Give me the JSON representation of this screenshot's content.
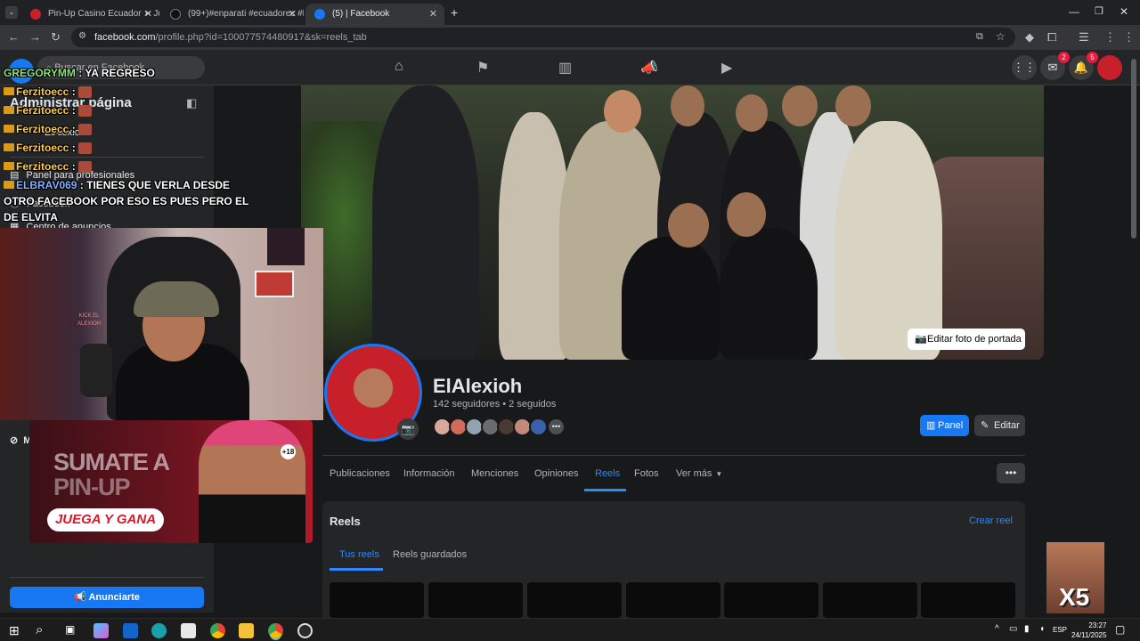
{
  "browser": {
    "tabs": [
      {
        "label": "Pin-Up Casino Ecuador ➤ Juga",
        "active": false
      },
      {
        "label": "(99+)#enparati #ecuadorec #ki",
        "active": false
      },
      {
        "label": "(5) | Facebook",
        "active": true
      }
    ],
    "url_host": "facebook.com",
    "url_path": "/profile.php?id=100077574480917&sk=reels_tab"
  },
  "fb_header": {
    "search_placeholder": "Buscar en Facebook",
    "messenger_badge": "2",
    "notifications_badge": "5"
  },
  "sidebar": {
    "title": "Administrar página",
    "page_name": "ElAlexioh",
    "items": [
      "Panel para profesionales",
      "Facebook",
      "Centro de anuncios"
    ],
    "partial_item": "Me",
    "ads_button": "Anunciarte"
  },
  "chat": [
    {
      "user": "GREGORYMM",
      "text": "YA REGRESO"
    },
    {
      "user": "Ferzitoecc",
      "text": ""
    },
    {
      "user": "Ferzitoecc",
      "text": ""
    },
    {
      "user": "Ferzitoecc",
      "text": ""
    },
    {
      "user": "Ferzitoecc",
      "text": ""
    },
    {
      "user": "Ferzitoecc",
      "text": ""
    },
    {
      "user": "ELBRAV069",
      "text": "TIENES QUE VERLA DESDE"
    },
    {
      "user": "",
      "text": "OTRO FACEBOOK POR ESO ES PUES PERO EL"
    },
    {
      "user": "",
      "text": "DE ELVITA"
    }
  ],
  "promo": {
    "line1": "SUMATE A",
    "line2": "PIN-UP",
    "cta": "JUEGA Y GANA",
    "age": "+18"
  },
  "webcam_sign": "KICK EL ALEXIOH",
  "overlay_multiplier": "X5",
  "cover": {
    "edit_label": "Editar foto de portada"
  },
  "profile": {
    "name": "ElAlexioh",
    "stats": "142 seguidores • 2 seguidos",
    "panel_button": "Panel",
    "edit_button": "Editar"
  },
  "profile_tabs": [
    {
      "label": "Publicaciones",
      "active": false
    },
    {
      "label": "Información",
      "active": false
    },
    {
      "label": "Menciones",
      "active": false
    },
    {
      "label": "Opiniones",
      "active": false
    },
    {
      "label": "Reels",
      "active": true
    },
    {
      "label": "Fotos",
      "active": false
    },
    {
      "label": "Ver más",
      "active": false
    }
  ],
  "reels": {
    "title": "Reels",
    "create_link": "Crear reel",
    "subtabs": [
      "Tus reels",
      "Reels guardados"
    ]
  },
  "taskbar": {
    "language": "ESP",
    "time": "23:27",
    "date": "24/11/2025"
  },
  "colors": {
    "fb_blue": "#1877f2",
    "fb_link_blue": "#2d88ff",
    "badge_red": "#e41e3f",
    "panel_bg": "#242526",
    "page_bg": "#18191a"
  }
}
